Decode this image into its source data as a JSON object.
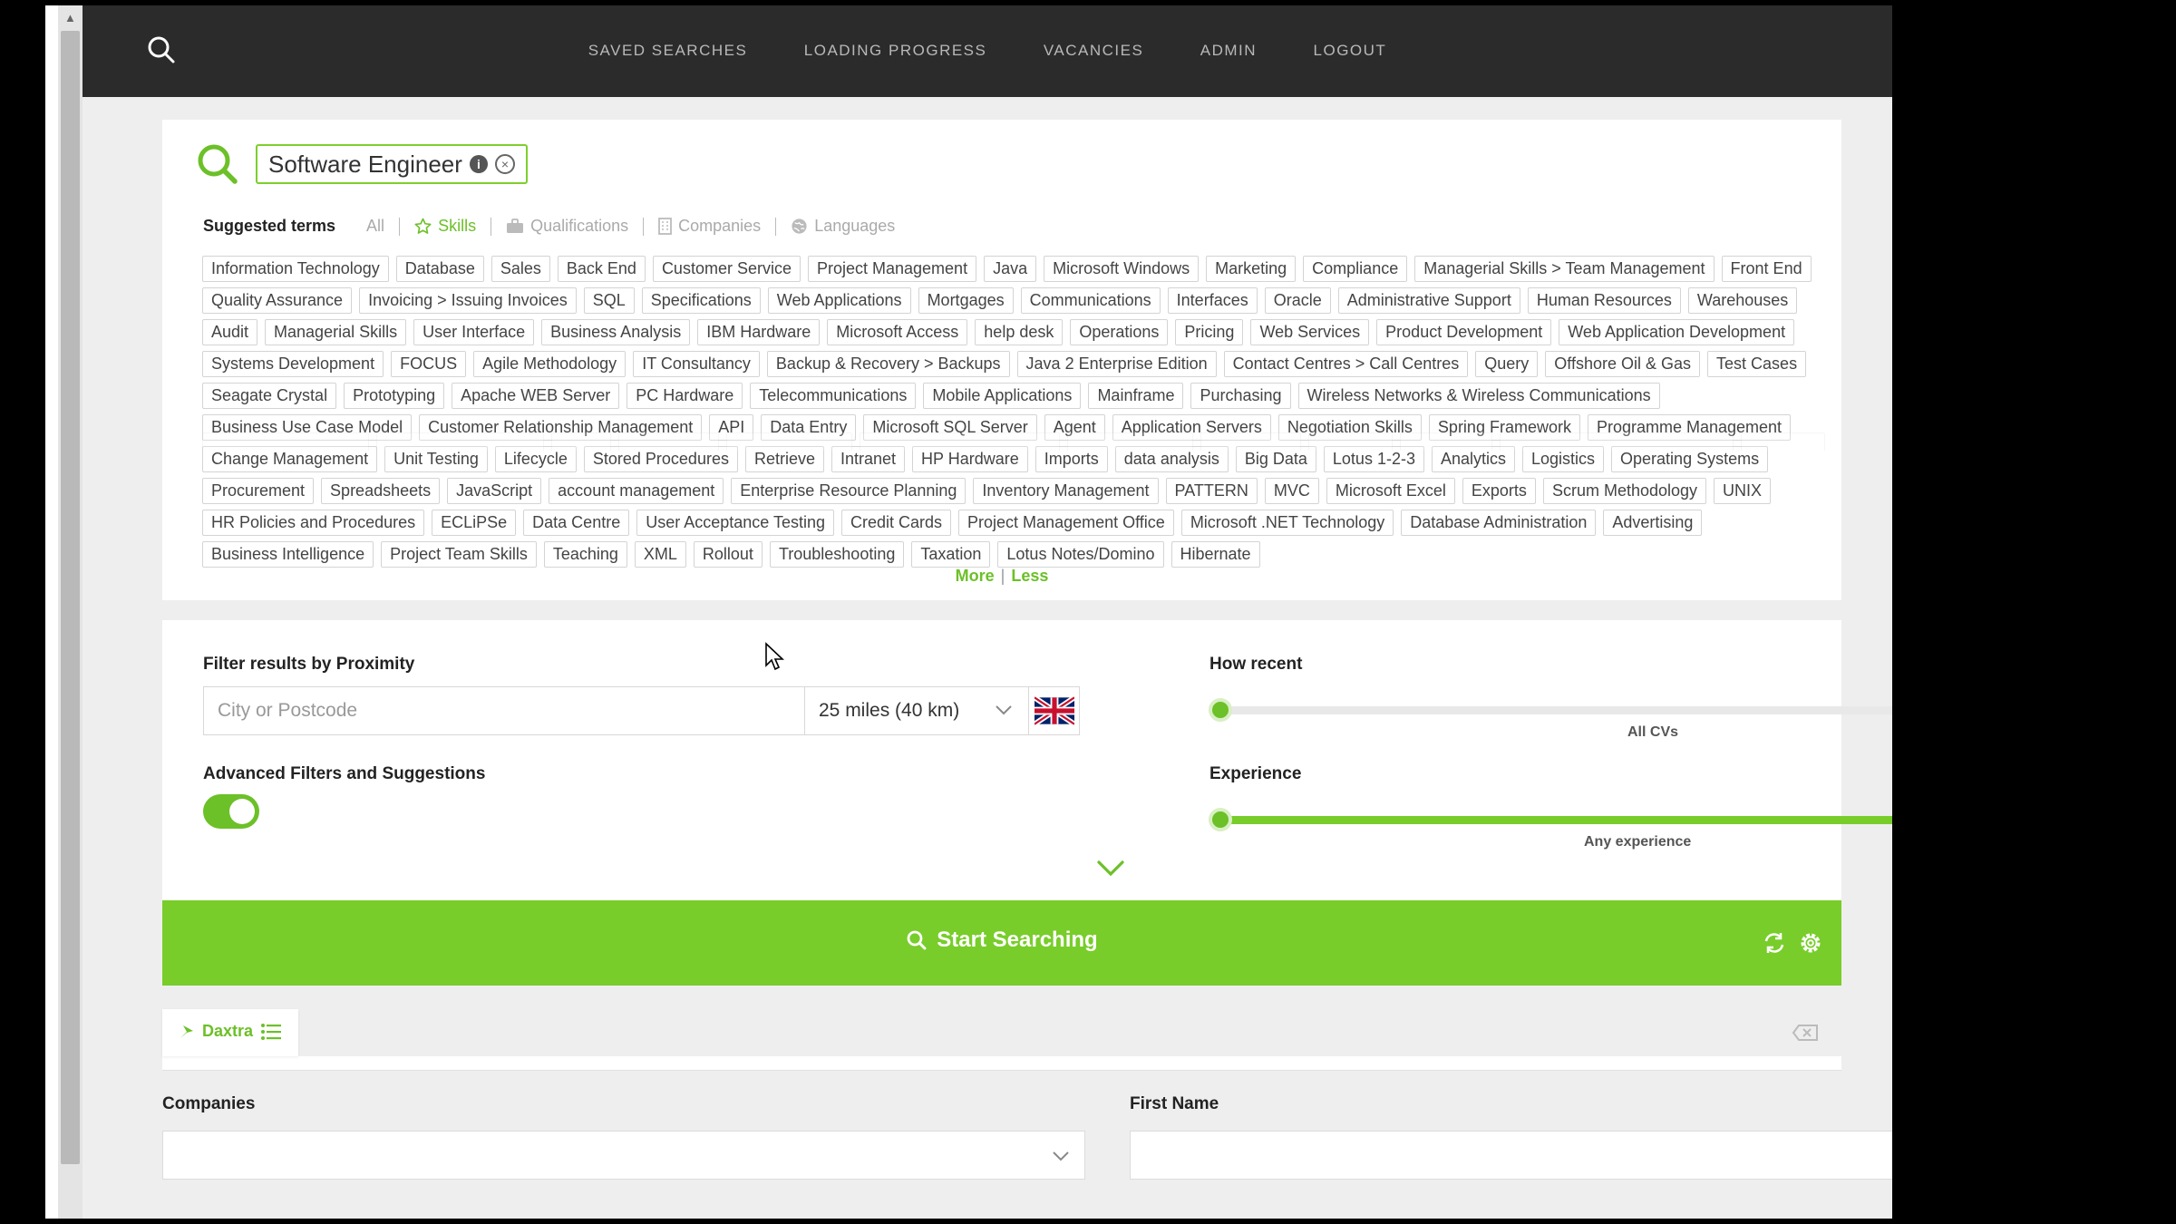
{
  "nav": {
    "links": [
      "SAVED SEARCHES",
      "LOADING PROGRESS",
      "VACANCIES",
      "ADMIN",
      "LOGOUT"
    ]
  },
  "search": {
    "term": "Software Engineer",
    "info_glyph": "i",
    "close_glyph": "×"
  },
  "suggested": {
    "title": "Suggested terms",
    "tabs": {
      "all": "All",
      "skills": "Skills",
      "qualifications": "Qualifications",
      "companies": "Companies",
      "languages": "Languages"
    },
    "tags": [
      "Information Technology",
      "Database",
      "Sales",
      "Back End",
      "Customer Service",
      "Project Management",
      "Java",
      "Microsoft Windows",
      "Marketing",
      "Compliance",
      "Managerial Skills > Team Management",
      "Front End",
      "Quality Assurance",
      "Invoicing > Issuing Invoices",
      "SQL",
      "Specifications",
      "Web Applications",
      "Mortgages",
      "Communications",
      "Interfaces",
      "Oracle",
      "Administrative Support",
      "Human Resources",
      "Warehouses",
      "Audit",
      "Managerial Skills",
      "User Interface",
      "Business Analysis",
      "IBM Hardware",
      "Microsoft Access",
      "help desk",
      "Operations",
      "Pricing",
      "Web Services",
      "Product Development",
      "Web Application Development",
      "Systems Development",
      "FOCUS",
      "Agile Methodology",
      "IT Consultancy",
      "Backup & Recovery > Backups",
      "Java 2 Enterprise Edition",
      "Contact Centres > Call Centres",
      "Query",
      "Offshore Oil & Gas",
      "Test Cases",
      "Seagate Crystal",
      "Prototyping",
      "Apache WEB Server",
      "PC Hardware",
      "Telecommunications",
      "Mobile Applications",
      "Mainframe",
      "Purchasing",
      "Wireless Networks & Wireless Communications",
      "Business Use Case Model",
      "Customer Relationship Management",
      "API",
      "Data Entry",
      "Microsoft SQL Server",
      "Agent",
      "Application Servers",
      "Negotiation Skills",
      "Spring Framework",
      "Programme Management",
      "Change Management",
      "Unit Testing",
      "Lifecycle",
      "Stored Procedures",
      "Retrieve",
      "Intranet",
      "HP Hardware",
      "Imports",
      "data analysis",
      "Big Data",
      "Lotus 1-2-3",
      "Analytics",
      "Logistics",
      "Operating Systems",
      "Procurement",
      "Spreadsheets",
      "JavaScript",
      "account management",
      "Enterprise Resource Planning",
      "Inventory Management",
      "PATTERN",
      "MVC",
      "Microsoft Excel",
      "Exports",
      "Scrum Methodology",
      "UNIX",
      "HR Policies and Procedures",
      "ECLiPSe",
      "Data Centre",
      "User Acceptance Testing",
      "Credit Cards",
      "Project Management Office",
      "Microsoft .NET Technology",
      "Database Administration",
      "Advertising",
      "Business Intelligence",
      "Project Team Skills",
      "Teaching",
      "XML",
      "Rollout",
      "Troubleshooting",
      "Taxation",
      "Lotus Notes/Domino",
      "Hibernate"
    ],
    "more": "More",
    "less": "Less",
    "separator": "|"
  },
  "filters": {
    "proximity_label": "Filter results by Proximity",
    "city_placeholder": "City or Postcode",
    "radius": "25 miles (40 km)",
    "advanced_label": "Advanced Filters and Suggestions",
    "advanced_enabled": true,
    "recent_label": "How recent",
    "recent_caption": "All CVs",
    "experience_label": "Experience",
    "experience_caption": "Any experience"
  },
  "start": {
    "label": "Start Searching"
  },
  "daxtra": {
    "tab_label": "Daxtra"
  },
  "lower": {
    "companies_label": "Companies",
    "firstname_label": "First Name"
  },
  "colors": {
    "accent": "#78cd2a",
    "nav_bg": "#2b2b2b",
    "page_bg": "#eeeeee"
  }
}
